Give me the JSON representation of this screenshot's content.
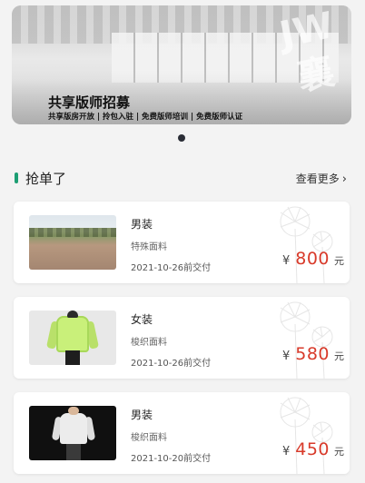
{
  "banner": {
    "title": "共享版师招募",
    "subtitle": "共享版房开放 | 拎包入驻 | 免费版师培训 | 免费版师认证",
    "watermark": "JW 襄匠"
  },
  "carousel": {
    "active_index": 0,
    "count": 1
  },
  "section": {
    "title": "抢单了",
    "more_label": "查看更多",
    "accent_color": "#1d9e73"
  },
  "orders": [
    {
      "name": "男装",
      "fabric": "特殊面料",
      "due": "2021-10-26前交付",
      "currency": "¥",
      "amount": "800",
      "unit": "元",
      "image": "grass-field"
    },
    {
      "name": "女装",
      "fabric": "梭织面料",
      "due": "2021-10-26前交付",
      "currency": "¥",
      "amount": "580",
      "unit": "元",
      "image": "lime-jacket"
    },
    {
      "name": "男装",
      "fabric": "梭织面料",
      "due": "2021-10-20前交付",
      "currency": "¥",
      "amount": "450",
      "unit": "元",
      "image": "runway-white-jacket"
    }
  ],
  "colors": {
    "price": "#d83a2a",
    "dot": "#2a2d36"
  }
}
